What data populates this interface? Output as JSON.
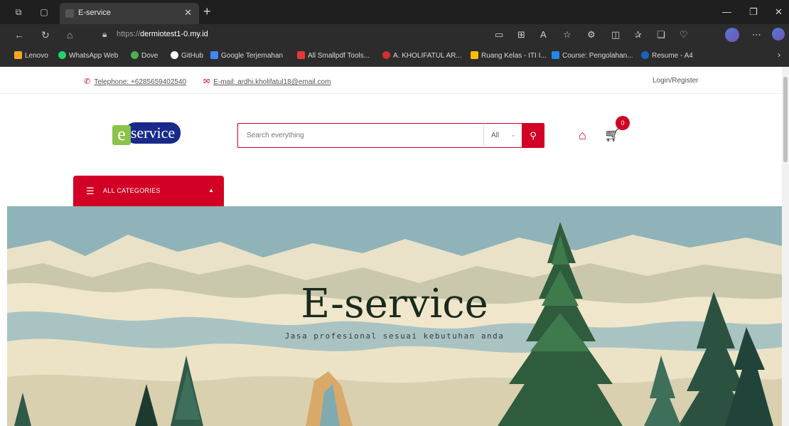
{
  "browser": {
    "tab_title": "E-service",
    "url_protocol": "https://",
    "url_host": "dermiotest1-0.my.id",
    "bookmarks": [
      {
        "label": "Lenovo",
        "color": "#f5a623"
      },
      {
        "label": "WhatsApp Web",
        "color": "#25d366"
      },
      {
        "label": "Dove",
        "color": "#4caf50"
      },
      {
        "label": "GitHub",
        "color": "#ffffff"
      },
      {
        "label": "Google Terjemahan",
        "color": "#4285f4"
      },
      {
        "label": "All Smallpdf Tools...",
        "color": "#e53935"
      },
      {
        "label": "A. KHOLIFATUL AR...",
        "color": "#d32f2f"
      },
      {
        "label": "Ruang Kelas - ITI I...",
        "color": "#fbbc04"
      },
      {
        "label": "Course: Pengolahan...",
        "color": "#1e88e5"
      },
      {
        "label": "Resume - A4",
        "color": "#1565c0"
      }
    ]
  },
  "topinfo": {
    "phone": "Telephone: +6285659402540",
    "email": "E-mail: ardhi.kholifatul18@email.com",
    "login": "Login/Register"
  },
  "logo": {
    "letter": "e",
    "word": "service"
  },
  "search": {
    "placeholder": "Search everything",
    "category": "All"
  },
  "cart": {
    "count": "0"
  },
  "categories": {
    "label": "ALL CATEGORIES"
  },
  "hero": {
    "title": "E-service",
    "subtitle": "Jasa profesional sesuai kebutuhan anda"
  },
  "colors": {
    "accent": "#d10024",
    "logo_blue": "#1a2a8a",
    "logo_green": "#8bc34a"
  }
}
